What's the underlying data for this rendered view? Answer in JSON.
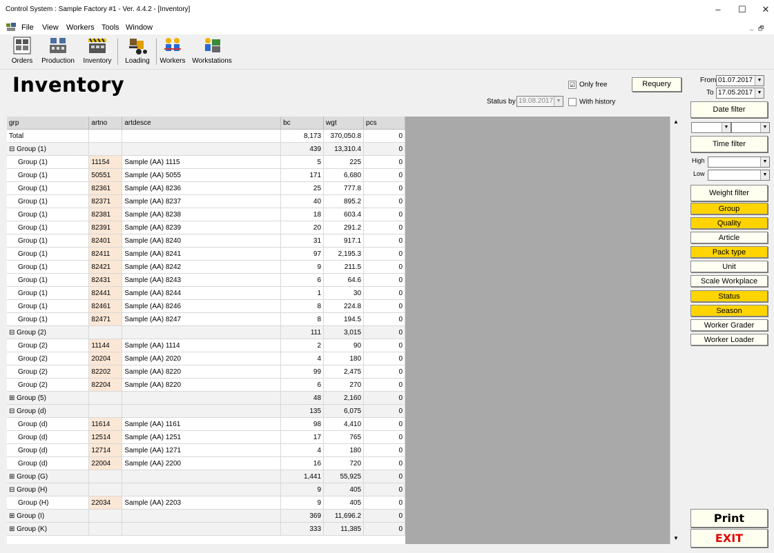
{
  "window": {
    "title": "Control System : Sample Factory #1   - Ver. 4.4.2 - [Inventory]",
    "minimize": "–",
    "maximize": "☐",
    "close": "✕"
  },
  "menu": {
    "items": [
      "File",
      "View",
      "Workers",
      "Tools",
      "Window"
    ],
    "mdi_min": "_",
    "mdi_restore": "🗗"
  },
  "toolbar": {
    "buttons": [
      "Orders",
      "Production",
      "Inventory",
      "Loading",
      "Workers",
      "Workstations"
    ]
  },
  "page_title": "Inventory",
  "filters": {
    "only_free_label": "Only free",
    "only_free_checked": "☑",
    "requery_label": "Requery",
    "status_by_label": "Status by",
    "status_by_value": "19.08.2017",
    "with_history_label": "With history",
    "from_label": "From",
    "from_value": "01.07.2017",
    "to_label": "To",
    "to_value": "17.05.2017",
    "date_filter_label": "Date filter",
    "time_filter_label": "Time filter",
    "high_label": "High",
    "low_label": "Low",
    "weight_filter_label": "Weight filter"
  },
  "grid": {
    "columns": [
      "grp",
      "artno",
      "artdesce",
      "bc",
      "wgt",
      "pcs"
    ],
    "rows": [
      {
        "grp": "Total",
        "artno": "",
        "artdesce": "",
        "bc": "8,173",
        "wgt": "370,050.8",
        "pcs": "0",
        "type": "total"
      },
      {
        "grp": "⊟ Group (1)",
        "artno": "",
        "artdesce": "",
        "bc": "439",
        "wgt": "13,310.4",
        "pcs": "0",
        "type": "group"
      },
      {
        "grp": "Group (1)",
        "artno": "11154",
        "artdesce": "Sample (AA) 1115",
        "bc": "5",
        "wgt": "225",
        "pcs": "0",
        "type": "item"
      },
      {
        "grp": "Group (1)",
        "artno": "50551",
        "artdesce": "Sample (AA) 5055",
        "bc": "171",
        "wgt": "6,680",
        "pcs": "0",
        "type": "item"
      },
      {
        "grp": "Group (1)",
        "artno": "82361",
        "artdesce": "Sample (AA) 8236",
        "bc": "25",
        "wgt": "777.8",
        "pcs": "0",
        "type": "item"
      },
      {
        "grp": "Group (1)",
        "artno": "82371",
        "artdesce": "Sample (AA) 8237",
        "bc": "40",
        "wgt": "895.2",
        "pcs": "0",
        "type": "item"
      },
      {
        "grp": "Group (1)",
        "artno": "82381",
        "artdesce": "Sample (AA) 8238",
        "bc": "18",
        "wgt": "603.4",
        "pcs": "0",
        "type": "item"
      },
      {
        "grp": "Group (1)",
        "artno": "82391",
        "artdesce": "Sample (AA) 8239",
        "bc": "20",
        "wgt": "291.2",
        "pcs": "0",
        "type": "item"
      },
      {
        "grp": "Group (1)",
        "artno": "82401",
        "artdesce": "Sample (AA) 8240",
        "bc": "31",
        "wgt": "917.1",
        "pcs": "0",
        "type": "item"
      },
      {
        "grp": "Group (1)",
        "artno": "82411",
        "artdesce": "Sample (AA) 8241",
        "bc": "97",
        "wgt": "2,195.3",
        "pcs": "0",
        "type": "item"
      },
      {
        "grp": "Group (1)",
        "artno": "82421",
        "artdesce": "Sample (AA) 8242",
        "bc": "9",
        "wgt": "211.5",
        "pcs": "0",
        "type": "item"
      },
      {
        "grp": "Group (1)",
        "artno": "82431",
        "artdesce": "Sample (AA) 8243",
        "bc": "6",
        "wgt": "64.6",
        "pcs": "0",
        "type": "item"
      },
      {
        "grp": "Group (1)",
        "artno": "82441",
        "artdesce": "Sample (AA) 8244",
        "bc": "1",
        "wgt": "30",
        "pcs": "0",
        "type": "item"
      },
      {
        "grp": "Group (1)",
        "artno": "82461",
        "artdesce": "Sample (AA) 8246",
        "bc": "8",
        "wgt": "224.8",
        "pcs": "0",
        "type": "item"
      },
      {
        "grp": "Group (1)",
        "artno": "82471",
        "artdesce": "Sample (AA) 8247",
        "bc": "8",
        "wgt": "194.5",
        "pcs": "0",
        "type": "item"
      },
      {
        "grp": "⊟ Group (2)",
        "artno": "",
        "artdesce": "",
        "bc": "111",
        "wgt": "3,015",
        "pcs": "0",
        "type": "group"
      },
      {
        "grp": "Group (2)",
        "artno": "11144",
        "artdesce": "Sample (AA) 1114",
        "bc": "2",
        "wgt": "90",
        "pcs": "0",
        "type": "item"
      },
      {
        "grp": "Group (2)",
        "artno": "20204",
        "artdesce": "Sample (AA) 2020",
        "bc": "4",
        "wgt": "180",
        "pcs": "0",
        "type": "item"
      },
      {
        "grp": "Group (2)",
        "artno": "82202",
        "artdesce": "Sample (AA) 8220",
        "bc": "99",
        "wgt": "2,475",
        "pcs": "0",
        "type": "item"
      },
      {
        "grp": "Group (2)",
        "artno": "82204",
        "artdesce": "Sample (AA) 8220",
        "bc": "6",
        "wgt": "270",
        "pcs": "0",
        "type": "item"
      },
      {
        "grp": "⊞ Group (5)",
        "artno": "",
        "artdesce": "",
        "bc": "48",
        "wgt": "2,160",
        "pcs": "0",
        "type": "group"
      },
      {
        "grp": "⊟ Group (d)",
        "artno": "",
        "artdesce": "",
        "bc": "135",
        "wgt": "6,075",
        "pcs": "0",
        "type": "group"
      },
      {
        "grp": "Group (d)",
        "artno": "11614",
        "artdesce": "Sample (AA) 1161",
        "bc": "98",
        "wgt": "4,410",
        "pcs": "0",
        "type": "item"
      },
      {
        "grp": "Group (d)",
        "artno": "12514",
        "artdesce": "Sample (AA) 1251",
        "bc": "17",
        "wgt": "765",
        "pcs": "0",
        "type": "item"
      },
      {
        "grp": "Group (d)",
        "artno": "12714",
        "artdesce": "Sample (AA) 1271",
        "bc": "4",
        "wgt": "180",
        "pcs": "0",
        "type": "item"
      },
      {
        "grp": "Group (d)",
        "artno": "22004",
        "artdesce": "Sample (AA) 2200",
        "bc": "16",
        "wgt": "720",
        "pcs": "0",
        "type": "item"
      },
      {
        "grp": "⊞ Group (G)",
        "artno": "",
        "artdesce": "",
        "bc": "1,441",
        "wgt": "55,925",
        "pcs": "0",
        "type": "group"
      },
      {
        "grp": "⊟ Group (H)",
        "artno": "",
        "artdesce": "",
        "bc": "9",
        "wgt": "405",
        "pcs": "0",
        "type": "group"
      },
      {
        "grp": "Group (H)",
        "artno": "22034",
        "artdesce": "Sample (AA) 2203",
        "bc": "9",
        "wgt": "405",
        "pcs": "0",
        "type": "item"
      },
      {
        "grp": "⊞ Group (I)",
        "artno": "",
        "artdesce": "",
        "bc": "369",
        "wgt": "11,696.2",
        "pcs": "0",
        "type": "group"
      },
      {
        "grp": "⊞ Group (K)",
        "artno": "",
        "artdesce": "",
        "bc": "333",
        "wgt": "11,385",
        "pcs": "0",
        "type": "group"
      }
    ]
  },
  "grouping_buttons": [
    {
      "label": "Group",
      "active": true
    },
    {
      "label": "Quality",
      "active": true
    },
    {
      "label": "Article",
      "active": false
    },
    {
      "label": "Pack type",
      "active": true
    },
    {
      "label": "Unit",
      "active": false
    },
    {
      "label": "Scale Workplace",
      "active": false
    },
    {
      "label": "Status",
      "active": true
    },
    {
      "label": "Season",
      "active": true
    },
    {
      "label": "Worker Grader",
      "active": false
    },
    {
      "label": "Worker Loader",
      "active": false
    }
  ],
  "colors": {
    "active": "#ffd400",
    "inactive": "#fffff4",
    "exit": "#e00000"
  },
  "actions": {
    "print_label": "Print",
    "exit_label": "EXIT"
  }
}
